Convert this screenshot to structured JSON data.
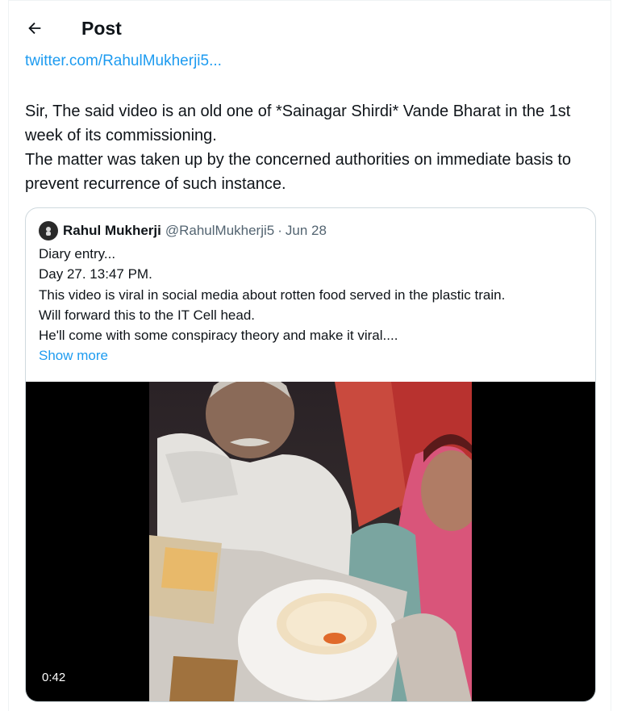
{
  "header": {
    "back_icon": "arrow-left-icon",
    "title": "Post"
  },
  "post": {
    "link": "twitter.com/RahulMukherji5...",
    "text_lines": [
      "Sir, The said video is an old one of *Sainagar Shirdi* Vande Bharat in the 1st week of its commissioning.",
      "The matter was taken up by the concerned authorities on immediate basis to prevent recurrence of such instance."
    ]
  },
  "quote": {
    "name": "Rahul Mukherji",
    "handle": "@RahulMukherji5",
    "separator": "·",
    "date": "Jun 28",
    "lines": [
      "Diary entry...",
      "Day 27. 13:47 PM.",
      "This video is viral in social media about rotten food served in the plastic train.",
      "Will forward this to the IT Cell head.",
      "He'll come with some conspiracy theory and make it viral...."
    ],
    "show_more": "Show more",
    "video": {
      "duration": "0:42"
    }
  },
  "colors": {
    "link": "#1d9bf0",
    "text": "#0f1419",
    "muted": "#536471",
    "border": "#cfd9de"
  }
}
